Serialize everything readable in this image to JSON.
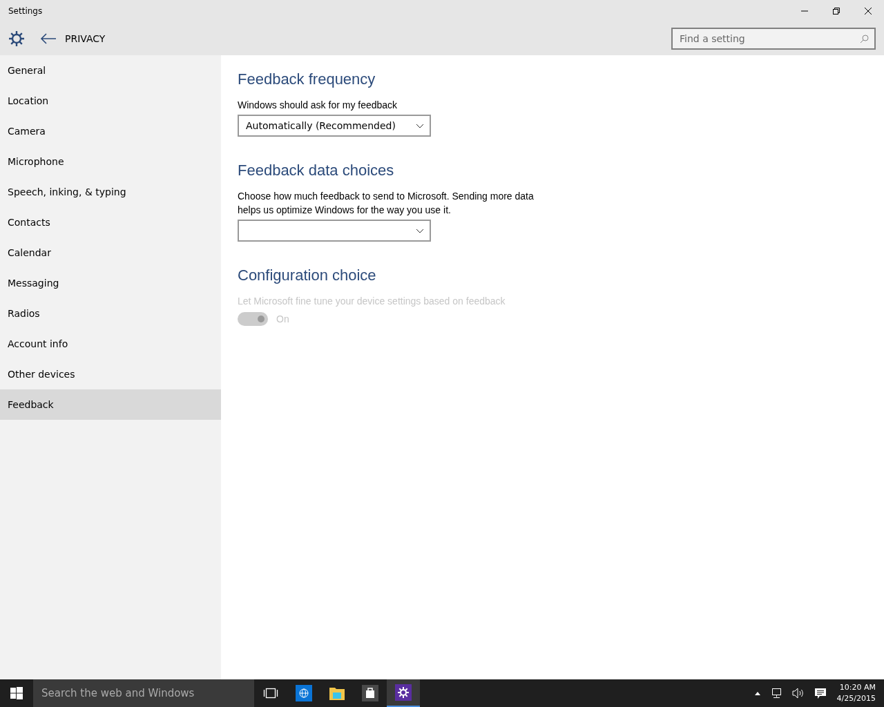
{
  "window": {
    "title": "Settings"
  },
  "header": {
    "page_title": "PRIVACY",
    "search": {
      "placeholder": "Find a setting"
    }
  },
  "sidebar": {
    "items": [
      {
        "label": "General",
        "selected": false
      },
      {
        "label": "Location",
        "selected": false
      },
      {
        "label": "Camera",
        "selected": false
      },
      {
        "label": "Microphone",
        "selected": false
      },
      {
        "label": "Speech, inking, & typing",
        "selected": false
      },
      {
        "label": "Contacts",
        "selected": false
      },
      {
        "label": "Calendar",
        "selected": false
      },
      {
        "label": "Messaging",
        "selected": false
      },
      {
        "label": "Radios",
        "selected": false
      },
      {
        "label": "Account info",
        "selected": false
      },
      {
        "label": "Other devices",
        "selected": false
      },
      {
        "label": "Feedback",
        "selected": true
      }
    ]
  },
  "sections": [
    {
      "heading": "Feedback frequency",
      "label": "Windows should ask for my feedback",
      "kind": "dropdown",
      "value": "Automatically (Recommended)",
      "disabled": false
    },
    {
      "heading": "Feedback data choices",
      "label": "Choose how much feedback to send to Microsoft. Sending more data helps us optimize Windows for the way you use it.",
      "kind": "dropdown",
      "disabled": false
    },
    {
      "heading": "Configuration choice",
      "label": "Let Microsoft fine tune your device settings based on feedback",
      "kind": "toggle",
      "on": true,
      "state_text": "On",
      "disabled": true
    }
  ],
  "taskbar": {
    "search": {
      "placeholder": "Search the web and Windows"
    },
    "apps": [
      {
        "kind": "task-view",
        "selected": false
      },
      {
        "kind": "browser",
        "selected": false
      },
      {
        "kind": "folder",
        "selected": false
      },
      {
        "kind": "store",
        "selected": false
      },
      {
        "kind": "settings",
        "selected": true
      }
    ],
    "time": "10:20 AM",
    "date": "4/25/2015"
  }
}
